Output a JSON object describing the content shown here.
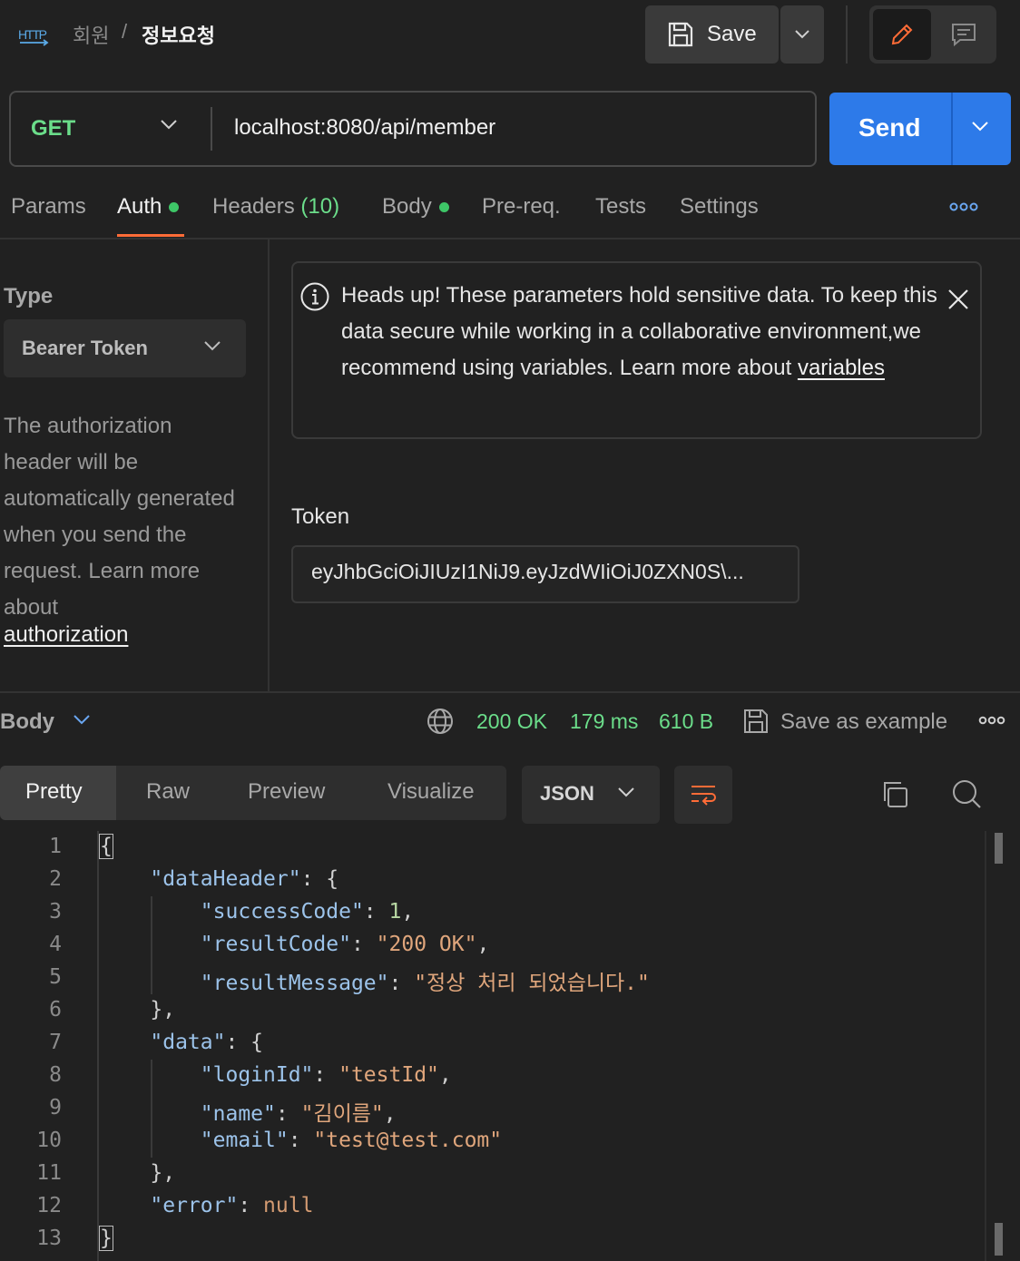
{
  "breadcrumb": {
    "icon": "http-icon",
    "parent": "회원",
    "separator": "/",
    "current": "정보요청"
  },
  "toolbar": {
    "save_label": "Save"
  },
  "request": {
    "method": "GET",
    "url": "localhost:8080/api/member",
    "send_label": "Send"
  },
  "request_tabs": {
    "params": "Params",
    "auth": "Auth",
    "headers": "Headers",
    "headers_count": "(10)",
    "body": "Body",
    "prereq": "Pre-req.",
    "tests": "Tests",
    "settings": "Settings"
  },
  "auth": {
    "type_label": "Type",
    "type_value": "Bearer Token",
    "description": "The authorization header will be automatically generated when you send the request. Learn more about",
    "description_link": "authorization",
    "notice_text": "Heads up! These parameters hold sensitive data. To keep this data secure while working in a collaborative environment,we recommend using variables. Learn more about",
    "notice_link": "variables",
    "token_label": "Token",
    "token_value": "eyJhbGciOiJIUzI1NiJ9.eyJzdWIiOiJ0ZXN0S\\..."
  },
  "response": {
    "body_label": "Body",
    "status": "200 OK",
    "time": "179 ms",
    "size": "610 B",
    "save_example": "Save as example",
    "view_tabs": {
      "pretty": "Pretty",
      "raw": "Raw",
      "preview": "Preview",
      "visualize": "Visualize"
    },
    "language": "JSON",
    "line_numbers": [
      "1",
      "2",
      "3",
      "4",
      "5",
      "6",
      "7",
      "8",
      "9",
      "10",
      "11",
      "12",
      "13"
    ],
    "json": {
      "dataHeader_key": "\"dataHeader\"",
      "successCode_key": "\"successCode\"",
      "successCode_val": "1",
      "resultCode_key": "\"resultCode\"",
      "resultCode_val": "\"200 OK\"",
      "resultMessage_key": "\"resultMessage\"",
      "resultMessage_val": "\"정상 처리 되었습니다.\"",
      "data_key": "\"data\"",
      "loginId_key": "\"loginId\"",
      "loginId_val": "\"testId\"",
      "name_key": "\"name\"",
      "name_val": "\"김이름\"",
      "email_key": "\"email\"",
      "email_val": "\"test@test.com\"",
      "error_key": "\"error\"",
      "error_val": "null"
    }
  },
  "colors": {
    "accent": "#ff6c37",
    "send": "#2d7ae9",
    "success": "#6bdd8a"
  }
}
